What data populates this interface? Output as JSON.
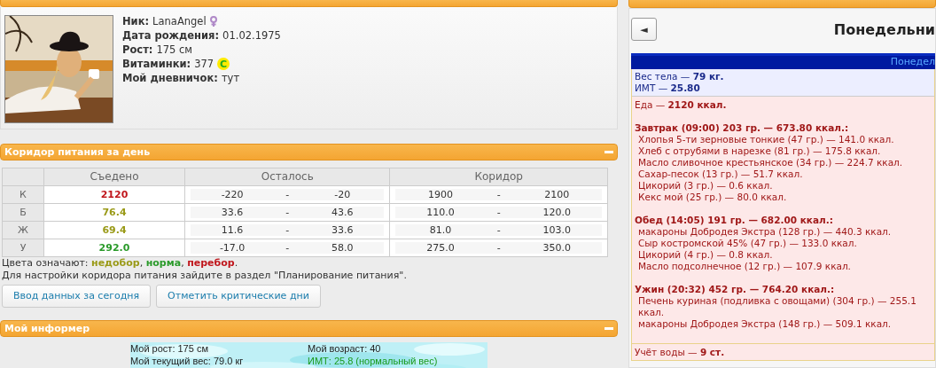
{
  "profile": {
    "fields": [
      {
        "label": "Ник:",
        "value": "LanaAngel",
        "kind": "gender"
      },
      {
        "label": "Дата рождения:",
        "value": "01.02.1975",
        "kind": "plain"
      },
      {
        "label": "Рост:",
        "value": "175 см",
        "kind": "plain"
      },
      {
        "label": "Витаминки:",
        "value": "377",
        "kind": "vitamin",
        "badge": "C"
      },
      {
        "label": "Мой дневничок:",
        "value": "тут",
        "kind": "link"
      }
    ]
  },
  "corridor": {
    "title": "Коридор питания за день",
    "columns": [
      "Съедено",
      "Осталось",
      "Коридор"
    ],
    "rows": [
      {
        "label": "К",
        "eaten": "2120",
        "color": "#c0161c",
        "left_min": "-220",
        "left_max": "-20",
        "min": "1900",
        "max": "2100"
      },
      {
        "label": "Б",
        "eaten": "76.4",
        "color": "#9a9a18",
        "left_min": "33.6",
        "left_max": "43.6",
        "min": "110.0",
        "max": "120.0"
      },
      {
        "label": "Ж",
        "eaten": "69.4",
        "color": "#9a9a18",
        "left_min": "11.6",
        "left_max": "33.6",
        "min": "81.0",
        "max": "103.0"
      },
      {
        "label": "У",
        "eaten": "292.0",
        "color": "#2a9a2a",
        "left_min": "-17.0",
        "left_max": "58.0",
        "min": "275.0",
        "max": "350.0"
      }
    ],
    "separator": "-",
    "legend_intro": "Цвета означают:",
    "legend": [
      {
        "text": "недобор",
        "color": "#9a9a18",
        "after": ","
      },
      {
        "text": "норма",
        "color": "#2a9a2a",
        "after": ","
      },
      {
        "text": "перебор",
        "color": "#c0161c",
        "after": "."
      }
    ],
    "note": "Для настройки коридора питания зайдите в раздел \"Планирование питания\".",
    "buttons": [
      "Ввод данных за сегодня",
      "Отметить критические дни"
    ]
  },
  "informer": {
    "title": "Мой информер",
    "lines": [
      {
        "text": "Мой рост: 175 см",
        "kind": "plain"
      },
      {
        "text": "Мой возраст: 40",
        "kind": "plain"
      },
      {
        "text": "Мой текущий вес: 79.0 кг",
        "kind": "plain"
      },
      {
        "text": "ИМТ: 25.8 (нормальный вес)",
        "kind": "good"
      }
    ]
  },
  "calendar": {
    "back_button": "◄",
    "day_title": "Понедельни",
    "day_bar": "Понедел",
    "body": [
      {
        "label": "Вес тела —",
        "value": "79 кг."
      },
      {
        "label": "ИМТ —",
        "value": "25.80"
      }
    ],
    "food": {
      "label": "Еда —",
      "value": "2120 ккал."
    },
    "meals": [
      {
        "title": "Завтрак (09:00) 203 гр. — 673.80 ккал.:",
        "items": [
          "Хлопья 5-ти зерновые тонкие (47 гр.) — 141.0 ккал.",
          "Хлеб с отрубями в нарезке (81 гр.) — 175.8 ккал.",
          "Масло сливочное крестьянское (34 гр.) — 224.7 ккал.",
          "Сахар-песок (13 гр.) — 51.7 ккал.",
          "Цикорий (3 гр.) — 0.6 ккал.",
          "Кекс мой (25 гр.) — 80.0 ккал."
        ]
      },
      {
        "title": "Обед (14:05) 191 гр. — 682.00 ккал.:",
        "items": [
          "макароны Добродея Экстра (128 гр.) — 440.3 ккал.",
          "Сыр костромской 45% (47 гр.) — 133.0 ккал.",
          "Цикорий (4 гр.) — 0.8 ккал.",
          "Масло подсолнечное (12 гр.) — 107.9 ккал."
        ]
      },
      {
        "title": "Ужин (20:32) 452 гр. — 764.20 ккал.:",
        "items": [
          "Печень куриная (подливка с овощами) (304 гр.) — 255.1 ккал.",
          "макароны Добродея Экстра (148 гр.) — 509.1 ккал."
        ]
      }
    ],
    "water": {
      "label": "Учёт воды —",
      "value": "9 ст."
    }
  }
}
